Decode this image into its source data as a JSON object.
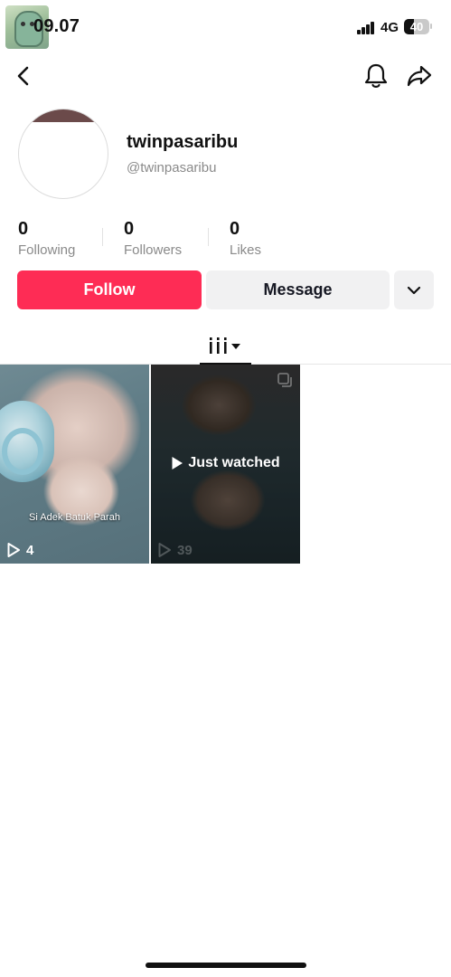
{
  "status_bar": {
    "time": "09.07",
    "network": "4G",
    "battery": "40",
    "battery_level": 0.4
  },
  "nav": {
    "back_icon": "chevron-left-icon",
    "bell_icon": "bell-icon",
    "share_icon": "share-arrow-icon"
  },
  "profile": {
    "display_name": "twinpasaribu",
    "handle": "@twinpasaribu"
  },
  "stats": [
    {
      "value": "0",
      "label": "Following"
    },
    {
      "value": "0",
      "label": "Followers"
    },
    {
      "value": "0",
      "label": "Likes"
    }
  ],
  "actions": {
    "follow": "Follow",
    "message": "Message",
    "more_icon": "chevron-down-icon"
  },
  "tabs": {
    "videos_icon": "grid-bars-icon"
  },
  "videos": [
    {
      "caption": "Si Adek Batuk Parah",
      "views": "4"
    },
    {
      "overlay": "Just watched",
      "views": "39"
    }
  ],
  "colors": {
    "accent": "#fe2c55",
    "secondary_button": "#f1f1f2",
    "muted_text": "#8a8a8a"
  }
}
